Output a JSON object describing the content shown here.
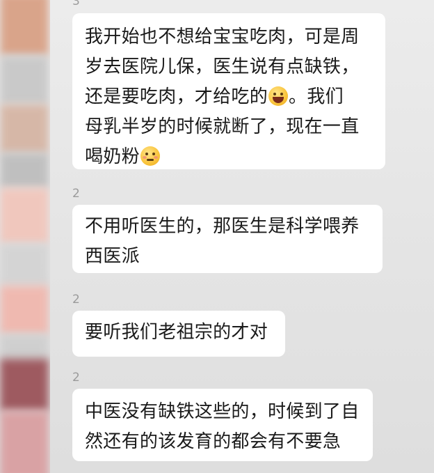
{
  "messages": [
    {
      "sender_tag": "3",
      "lines": [
        "我开始也不想给宝宝吃肉，可是周",
        "岁去医院儿保，医生说有点缺铁，",
        "还是要吃肉，才给吃的",
        "。我们",
        "母乳半岁的时候就断了，现在一直",
        "喝奶粉"
      ]
    },
    {
      "sender_tag": "2",
      "lines": [
        "不用听医生的，那医生是科学喂养",
        "西医派"
      ]
    },
    {
      "sender_tag": "2",
      "lines": [
        "要听我们老祖宗的才对"
      ]
    },
    {
      "sender_tag": "2",
      "lines": [
        "中医没有缺铁这些的，时候到了自",
        "然还有的该发育的都会有不要急"
      ]
    }
  ],
  "emojis": {
    "first": "laughing-face-emoji",
    "second": "woozy-face-emoji"
  },
  "colors": {
    "bubble": "#ffffff",
    "background": "#e6e6e6",
    "text": "#1a1a1a",
    "sender_tag": "#9a9a9a"
  }
}
